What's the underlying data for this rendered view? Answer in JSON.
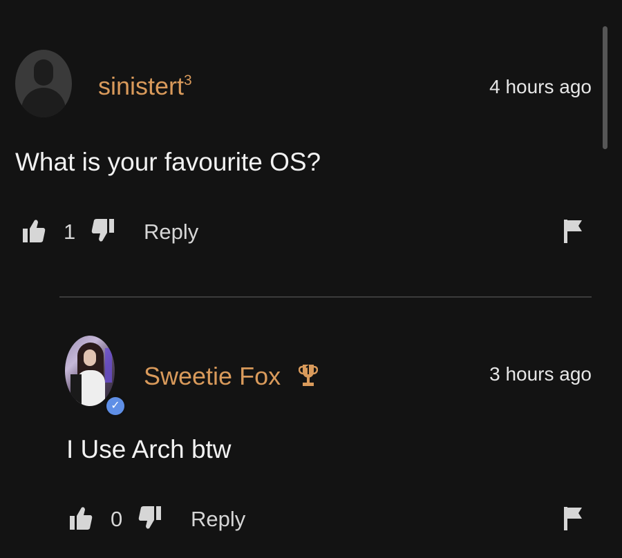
{
  "comments": [
    {
      "username": "sinistert",
      "username_superscript": "3",
      "timestamp": "4 hours ago",
      "text": "What is your favourite OS?",
      "likes": "1",
      "reply_label": "Reply",
      "avatar": "default-silhouette"
    },
    {
      "username": "Sweetie Fox",
      "badge_icon": "trophy-icon",
      "verified": true,
      "timestamp": "3 hours ago",
      "text": "I Use Arch btw",
      "likes": "0",
      "reply_label": "Reply",
      "avatar": "user-photo"
    }
  ],
  "colors": {
    "background": "#131313",
    "username": "#d99a5b",
    "text": "#f2f2f2",
    "verified": "#5f8fe6",
    "divider": "#3c3c3c"
  },
  "icons": [
    "thumbs-up-icon",
    "thumbs-down-icon",
    "flag-icon",
    "trophy-icon",
    "verified-check-icon"
  ]
}
